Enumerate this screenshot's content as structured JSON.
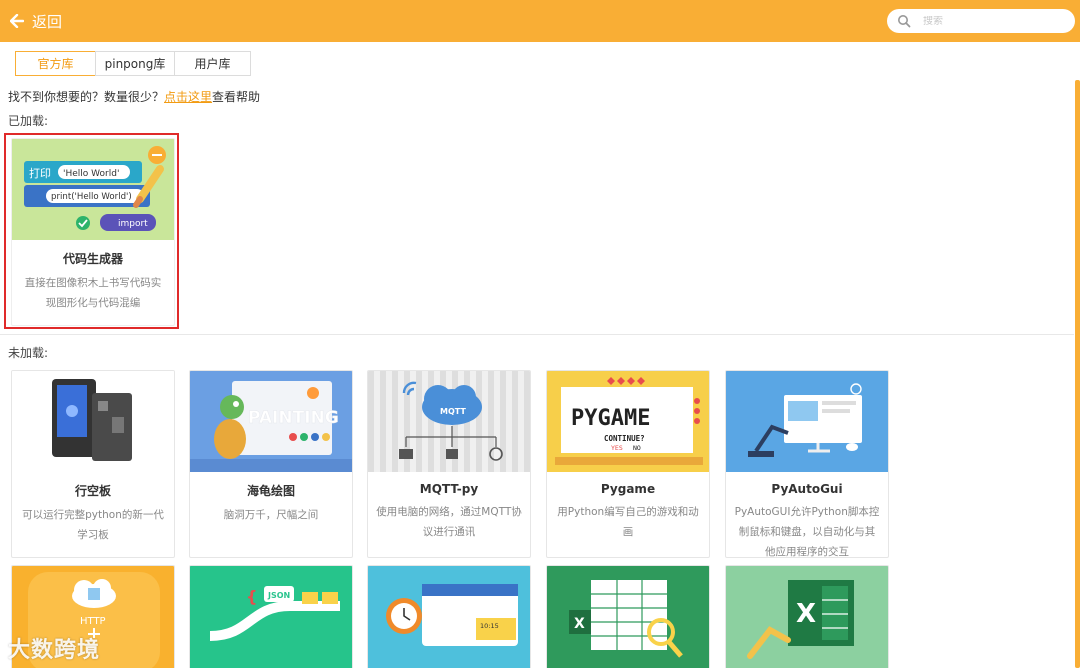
{
  "header": {
    "back_label": "返回",
    "search_placeholder": "搜索"
  },
  "tabs": [
    {
      "label": "官方库",
      "active": true
    },
    {
      "label": "pinpong库",
      "active": false
    },
    {
      "label": "用户库",
      "active": false
    }
  ],
  "help": {
    "prefix": "找不到你想要的？数量很少？",
    "link": "点击这里",
    "suffix": "查看帮助"
  },
  "sections": {
    "loaded": "已加载:",
    "unloaded": "未加载:"
  },
  "loaded_cards": [
    {
      "title": "代码生成器",
      "desc": "直接在图像积木上书写代码实现图形化与代码混编",
      "thumb_text": {
        "print_block": "打印",
        "hello": "'Hello World'",
        "print_call": "print('Hello World')",
        "import": "import"
      }
    }
  ],
  "unloaded_cards": [
    {
      "title": "行空板",
      "desc": "可以运行完整python的新一代学习板"
    },
    {
      "title": "海龟绘图",
      "desc": "脑洞万千，尺幅之间",
      "thumb_text": "PAINTING"
    },
    {
      "title": "MQTT-py",
      "desc": "使用电脑的网络，通过MQTT协议进行通讯",
      "thumb_text": "MQTT"
    },
    {
      "title": "Pygame",
      "desc": "用Python编写自己的游戏和动画",
      "thumb_text": {
        "logo": "PYGAME",
        "continue": "CONTINUE?",
        "yes": "YES",
        "no": "NO"
      }
    },
    {
      "title": "PyAutoGui",
      "desc": "PyAutoGUI允许Python脚本控制鼠标和键盘，以自动化与其他应用程序的交互"
    }
  ],
  "bottom_cards": [
    {
      "thumb_text": "HTTP"
    },
    {
      "thumb_text": "JSON"
    },
    {
      "thumb_text": "10:15"
    },
    {
      "thumb_text": "X"
    },
    {
      "thumb_text": "X"
    }
  ],
  "watermark": "大数跨境",
  "colors": {
    "accent": "#f9ae35",
    "selected_border": "#e02a2a"
  }
}
